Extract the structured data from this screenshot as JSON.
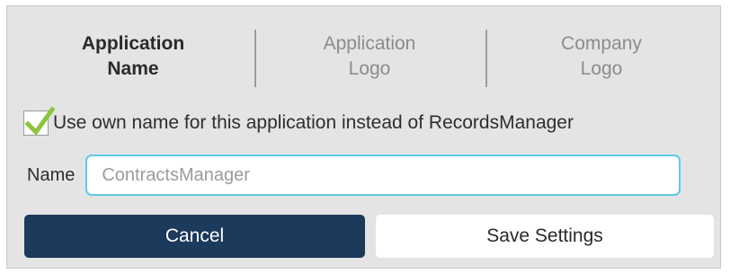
{
  "tabs": [
    {
      "line1": "Application",
      "line2": "Name",
      "active": true
    },
    {
      "line1": "Application",
      "line2": "Logo",
      "active": false
    },
    {
      "line1": "Company",
      "line2": "Logo",
      "active": false
    }
  ],
  "checkbox": {
    "label": "Use own name for this application instead of RecordsManager",
    "checked": true,
    "check_color": "#8cc63f"
  },
  "name_field": {
    "label": "Name",
    "value": "ContractsManager",
    "border_color": "#5fc9e6"
  },
  "buttons": {
    "cancel_label": "Cancel",
    "save_label": "Save Settings",
    "cancel_color": "#1b3a5c"
  }
}
